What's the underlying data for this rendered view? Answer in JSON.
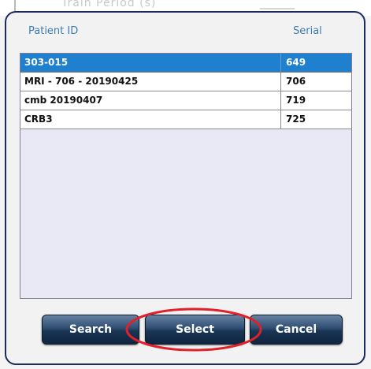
{
  "background": {
    "partial_label": "Train Period (s)"
  },
  "table": {
    "headers": {
      "patient_id": "Patient ID",
      "serial": "Serial"
    },
    "rows": [
      {
        "patient_id": "303-015",
        "serial": "649",
        "selected": true
      },
      {
        "patient_id": "MRI - 706 - 20190425",
        "serial": "706",
        "selected": false
      },
      {
        "patient_id": "cmb 20190407",
        "serial": "719",
        "selected": false
      },
      {
        "patient_id": "CRB3",
        "serial": "725",
        "selected": false
      }
    ]
  },
  "buttons": {
    "search": "Search",
    "select": "Select",
    "cancel": "Cancel"
  },
  "colors": {
    "dialog_border": "#1d2a5c",
    "header_text": "#3d7db0",
    "selected_row": "#1f80cf",
    "list_background": "#e9e9f6",
    "annotation": "#e0202a"
  }
}
